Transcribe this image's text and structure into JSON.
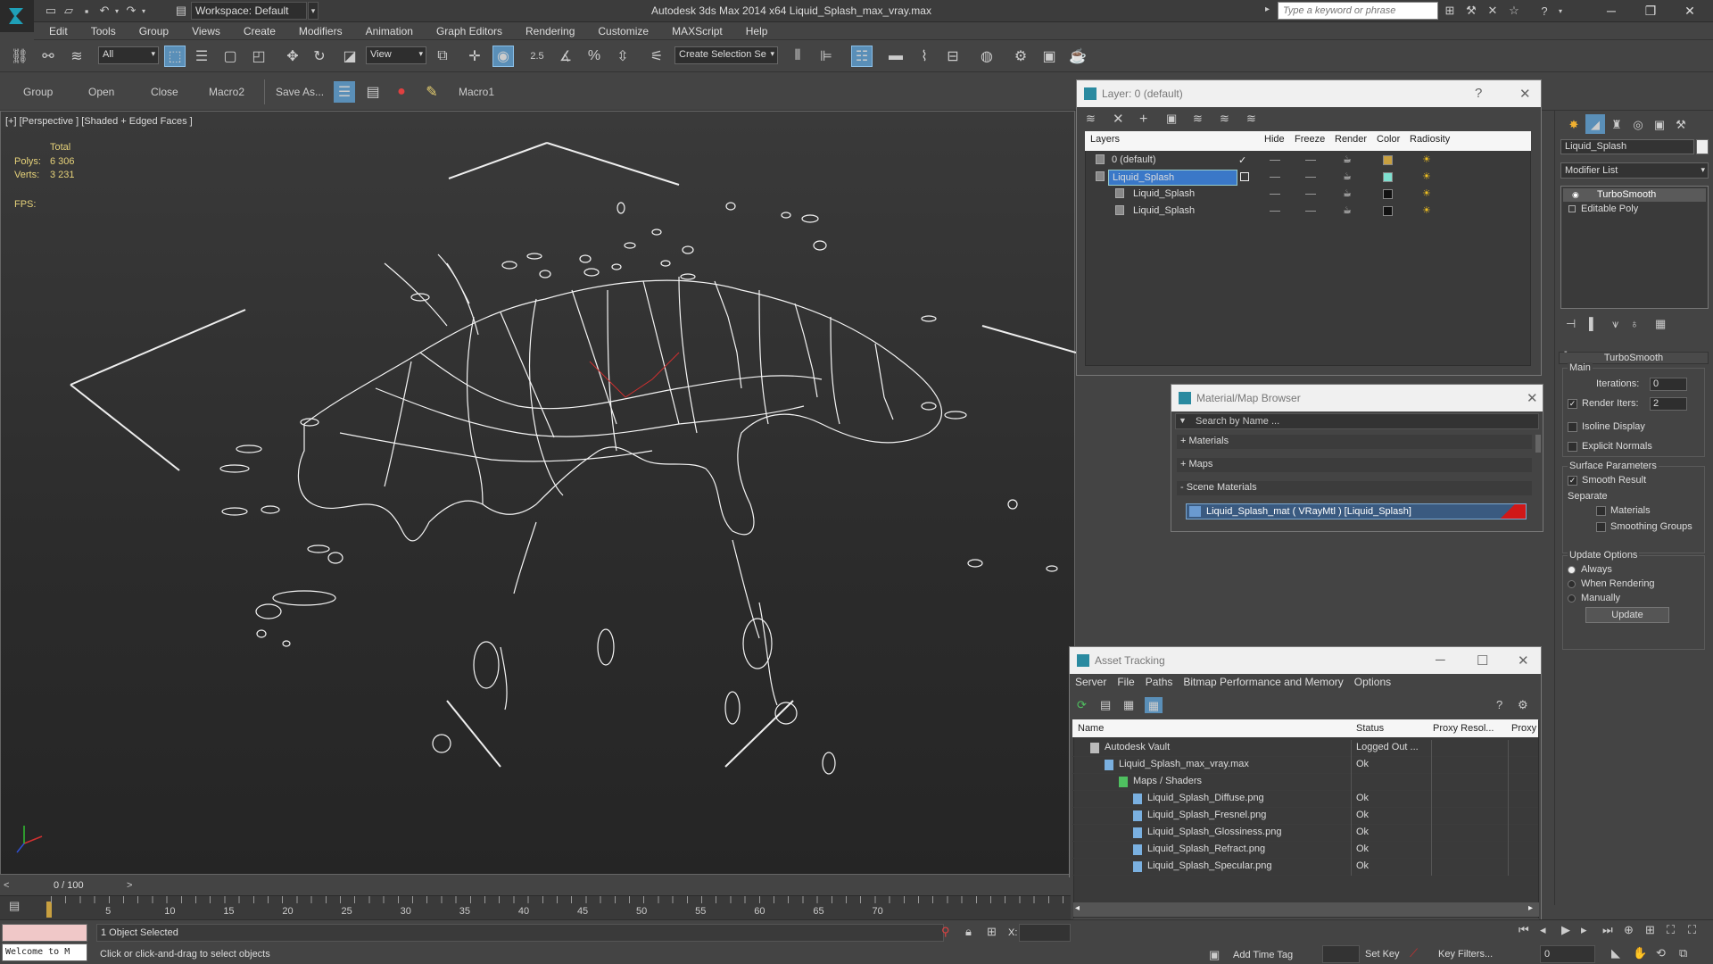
{
  "app": {
    "title": "Autodesk 3ds Max  2014 x64    Liquid_Splash_max_vray.max",
    "workspace": "Workspace: Default",
    "search_placeholder": "Type a keyword or phrase"
  },
  "menu": [
    "Edit",
    "Tools",
    "Group",
    "Views",
    "Create",
    "Modifiers",
    "Animation",
    "Graph Editors",
    "Rendering",
    "Customize",
    "MAXScript",
    "Help"
  ],
  "toolbar": {
    "selection_filter": "All",
    "ref_coord": "View",
    "snap_angle": "2.5",
    "named_selection": "Create Selection Se"
  },
  "toolbar2": [
    "Group",
    "Open",
    "Close",
    "Macro2",
    "Save As...",
    "Macro1"
  ],
  "viewport": {
    "label": "[+] [Perspective ] [Shaded + Edged Faces ]",
    "stats_header": "Total",
    "polys_label": "Polys:",
    "polys_value": "6 306",
    "verts_label": "Verts:",
    "verts_value": "3 231",
    "fps_label": "FPS:"
  },
  "layer_panel": {
    "title": "Layer: 0 (default)",
    "columns": [
      "Layers",
      "Hide",
      "Freeze",
      "Render",
      "Color",
      "Radiosity"
    ],
    "rows": [
      {
        "name": "0 (default)",
        "color": "#c8a040",
        "selected": false,
        "indent": 0
      },
      {
        "name": "Liquid_Splash",
        "color": "#7fe0d0",
        "selected": true,
        "indent": 0
      },
      {
        "name": "Liquid_Splash",
        "color": "#111111",
        "selected": false,
        "indent": 1
      },
      {
        "name": "Liquid_Splash",
        "color": "#111111",
        "selected": false,
        "indent": 1
      }
    ]
  },
  "material_browser": {
    "title": "Material/Map Browser",
    "search_placeholder": "Search by Name ...",
    "sections": [
      "+ Materials",
      "+ Maps",
      "- Scene Materials"
    ],
    "scene_material": "Liquid_Splash_mat ( VRayMtl ) [Liquid_Splash]"
  },
  "command_panel": {
    "object_name": "Liquid_Splash",
    "modifier_list": "Modifier List",
    "stack": [
      "TurboSmooth",
      "Editable Poly"
    ],
    "rollout_title": "TurboSmooth",
    "main_label": "Main",
    "iterations_label": "Iterations:",
    "iterations_value": "0",
    "render_iters_label": "Render Iters:",
    "render_iters_value": "2",
    "isoline": "Isoline Display",
    "explicit_normals": "Explicit Normals",
    "surface_params": "Surface Parameters",
    "smooth_result": "Smooth Result",
    "separate": "Separate",
    "materials": "Materials",
    "smoothing_groups": "Smoothing Groups",
    "update_options": "Update Options",
    "always": "Always",
    "when_rendering": "When Rendering",
    "manually": "Manually",
    "update_button": "Update"
  },
  "asset_tracking": {
    "title": "Asset Tracking",
    "menu": [
      "Server",
      "File",
      "Paths",
      "Bitmap Performance and Memory",
      "Options"
    ],
    "columns": [
      "Name",
      "Status",
      "Proxy Resol...",
      "Proxy"
    ],
    "rows": [
      {
        "name": "Autodesk Vault",
        "status": "Logged Out ...",
        "indent": 1
      },
      {
        "name": "Liquid_Splash_max_vray.max",
        "status": "Ok",
        "indent": 2
      },
      {
        "name": "Maps / Shaders",
        "status": "",
        "indent": 3
      },
      {
        "name": "Liquid_Splash_Diffuse.png",
        "status": "Ok",
        "indent": 4
      },
      {
        "name": "Liquid_Splash_Fresnel.png",
        "status": "Ok",
        "indent": 4
      },
      {
        "name": "Liquid_Splash_Glossiness.png",
        "status": "Ok",
        "indent": 4
      },
      {
        "name": "Liquid_Splash_Refract.png",
        "status": "Ok",
        "indent": 4
      },
      {
        "name": "Liquid_Splash_Specular.png",
        "status": "Ok",
        "indent": 4
      }
    ]
  },
  "timeline": {
    "frame": "0 / 100",
    "ticks": [
      "5",
      "10",
      "15",
      "20",
      "25",
      "30",
      "35",
      "40",
      "45",
      "50",
      "55",
      "60",
      "65",
      "70"
    ]
  },
  "status": {
    "welcome": "Welcome to M",
    "selected": "1 Object Selected",
    "prompt": "Click or click-and-drag to select objects",
    "x_label": "X:",
    "add_time_tag": "Add Time Tag",
    "set_key": "Set Key",
    "key_filters": "Key Filters...",
    "frame_field": "0"
  }
}
